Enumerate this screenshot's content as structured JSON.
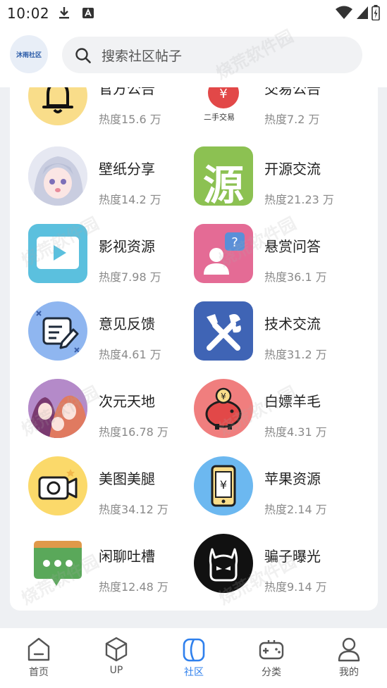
{
  "status_bar": {
    "time": "10:02",
    "icons": [
      "download-icon",
      "a-icon",
      "wifi-icon",
      "signal-icon",
      "battery-icon"
    ]
  },
  "header": {
    "logo_text": "沐雨社区",
    "search_placeholder": "搜索社区帖子",
    "watermark": "烧荒软件园"
  },
  "items": [
    {
      "title": "官方公告",
      "heat": "热度15.6 万",
      "icon": "bell-icon"
    },
    {
      "title": "交易公告",
      "heat": "热度7.2 万",
      "icon": "second-hand-trade-icon",
      "icon_text": "二手交易"
    },
    {
      "title": "壁纸分享",
      "heat": "热度14.2 万",
      "icon": "anime-girl-avatar-icon"
    },
    {
      "title": "开源交流",
      "heat": "热度21.23 万",
      "icon": "yuan-character-icon",
      "icon_text": "源"
    },
    {
      "title": "影视资源",
      "heat": "热度7.98 万",
      "icon": "video-play-icon"
    },
    {
      "title": "悬赏问答",
      "heat": "热度36.1 万",
      "icon": "question-person-icon"
    },
    {
      "title": "意见反馈",
      "heat": "热度4.61 万",
      "icon": "feedback-edit-icon"
    },
    {
      "title": "技术交流",
      "heat": "热度31.2 万",
      "icon": "tools-icon"
    },
    {
      "title": "次元天地",
      "heat": "热度16.78 万",
      "icon": "anime-group-avatar-icon"
    },
    {
      "title": "白嫖羊毛",
      "heat": "热度4.31 万",
      "icon": "piggy-bank-icon"
    },
    {
      "title": "美图美腿",
      "heat": "热度34.12 万",
      "icon": "camera-icon"
    },
    {
      "title": "苹果资源",
      "heat": "热度2.14 万",
      "icon": "phone-yen-icon"
    },
    {
      "title": "闲聊吐槽",
      "heat": "热度12.48 万",
      "icon": "chat-bubble-icon"
    },
    {
      "title": "骗子曝光",
      "heat": "热度9.14 万",
      "icon": "devil-face-icon"
    }
  ],
  "bottom_nav": [
    {
      "label": "首页",
      "icon": "home-icon",
      "active": false
    },
    {
      "label": "UP",
      "icon": "cube-icon",
      "active": false
    },
    {
      "label": "社区",
      "icon": "community-icon",
      "active": true
    },
    {
      "label": "分类",
      "icon": "gamepad-icon",
      "active": false
    },
    {
      "label": "我的",
      "icon": "profile-icon",
      "active": false
    }
  ],
  "colors": {
    "accent": "#2f80ed",
    "bell_bg": "#f9dd8a",
    "yuan_bg": "#8cc152",
    "video_bg": "#5bc0de",
    "question_bg": "#e46b95",
    "feedback_bg": "#8fb6f0",
    "tools_bg": "#3f64b5",
    "piggy_bg": "#f07e7e",
    "camera_bg": "#fbd96a",
    "phone_bg": "#6cb8f0",
    "chat_bg": "#5aa85a",
    "devil_bg": "#111111"
  }
}
